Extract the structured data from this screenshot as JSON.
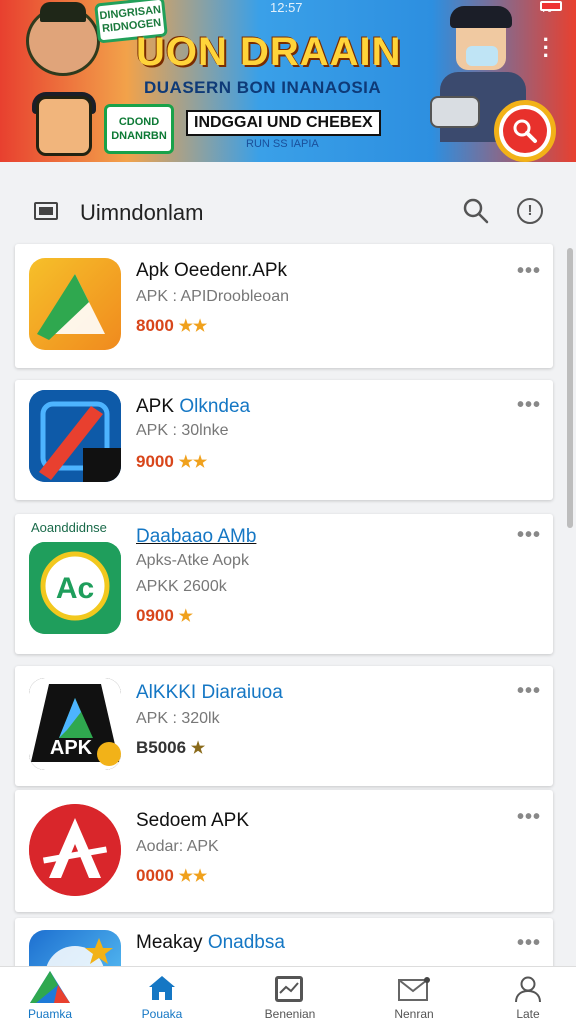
{
  "status_bar": {
    "time": "12:57",
    "right_text": "%"
  },
  "banner": {
    "badge_top": "DINGRISAN\nRIDNOGEN",
    "title": "UON DRAAIN",
    "subtitle": "DUASERN BON INANAOSIA",
    "badge_green": "CDOND\nDNANRBN",
    "pill": "INDGGAI UND CHEBEX",
    "small_sub": "RUN SS IAPIA"
  },
  "header": {
    "title": "Uimndonlam"
  },
  "apps": [
    {
      "name_plain": "Apk Oeedenr.APk",
      "name_hl": "",
      "meta": "APK : APIDroobleoan",
      "meta2": "",
      "rating": "8000",
      "tag": ""
    },
    {
      "name_plain": "APK ",
      "name_hl": "Olkndea",
      "meta": "APK : 30lnke",
      "meta2": "",
      "rating": "9000",
      "tag": ""
    },
    {
      "name_plain": "",
      "name_hl": "Daabaao AMb",
      "meta": "Apks-Atke Aopk",
      "meta2": "APKK 2600k",
      "rating": "0900",
      "tag": "Aoanddidnse"
    },
    {
      "name_plain": "",
      "name_hl": "AlKKKI Diaraiuoa",
      "meta": "APK : 320lk",
      "meta2": "",
      "rating": "B5006",
      "tag": ""
    },
    {
      "name_plain": "Sedoem APK",
      "name_hl": "",
      "meta": "Aodar: APK",
      "meta2": "",
      "rating": "0000",
      "tag": ""
    },
    {
      "name_plain": "Meakay ",
      "name_hl": "Onadbsa",
      "meta": "",
      "meta2": "",
      "rating": "",
      "tag": ""
    }
  ],
  "icon_text": {
    "app3": "Ac",
    "app4": "APK"
  },
  "nav": [
    {
      "label": "Puamka",
      "icon": "apk-logo-icon"
    },
    {
      "label": "Pouaka",
      "icon": "home-icon"
    },
    {
      "label": "Benenian",
      "icon": "chart-icon"
    },
    {
      "label": "Nenran",
      "icon": "mail-icon"
    },
    {
      "label": "Late",
      "icon": "person-icon"
    }
  ],
  "colors": {
    "accent": "#1577c4",
    "rating": "#d8461b",
    "star": "#f0a11d",
    "banner_red": "#e8402f",
    "search_red": "#e8312c"
  }
}
